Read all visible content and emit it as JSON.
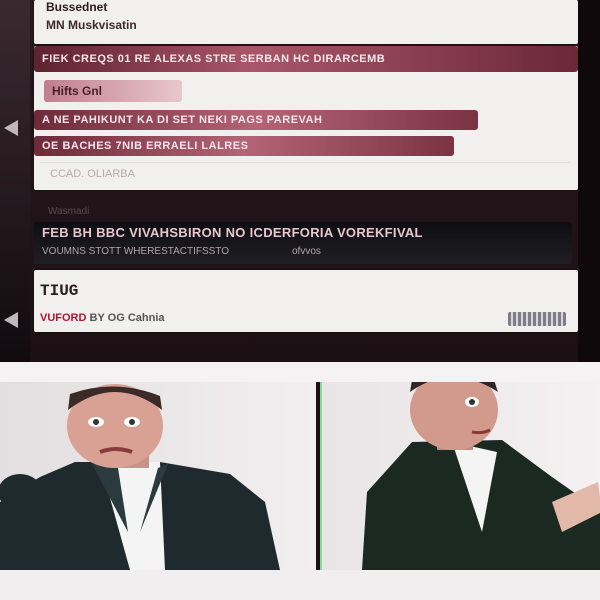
{
  "header": {
    "site_title": "Bussednet",
    "site_subtitle": "MN Muskvisatin"
  },
  "main": {
    "headline_bar": "FIEK  CREQS 01 RE ALEXAS STRE SERBAN HC DIRARCEMB",
    "tab_label": "Hifts  Gnl",
    "bar2": "A  NE PAHIKUNT KA DI SET NEKI PAGS PAREVAH",
    "bar3": "OE BACHES 7NIB ERRAELI LALRES",
    "placeholder": "CCAD.  OLIARBA"
  },
  "section_label": "Wasmadi",
  "dark_bar": {
    "line1": "FEB BH BBC VIVAHSBIRON NO ICDERFORIA VOREKFIVAL",
    "line2_left": "VOUMNS STOTT WHERESTACTIFSSTO",
    "line2_right": "ofvvos"
  },
  "info": {
    "title": "TIUG",
    "meta_red": "VUFORD",
    "meta_gray": "BY OG Cahnia"
  },
  "colors": {
    "accent": "#a9566a",
    "dark_bar": "#14141a",
    "panel": "#f2efef",
    "meta_red": "#b0182f"
  }
}
